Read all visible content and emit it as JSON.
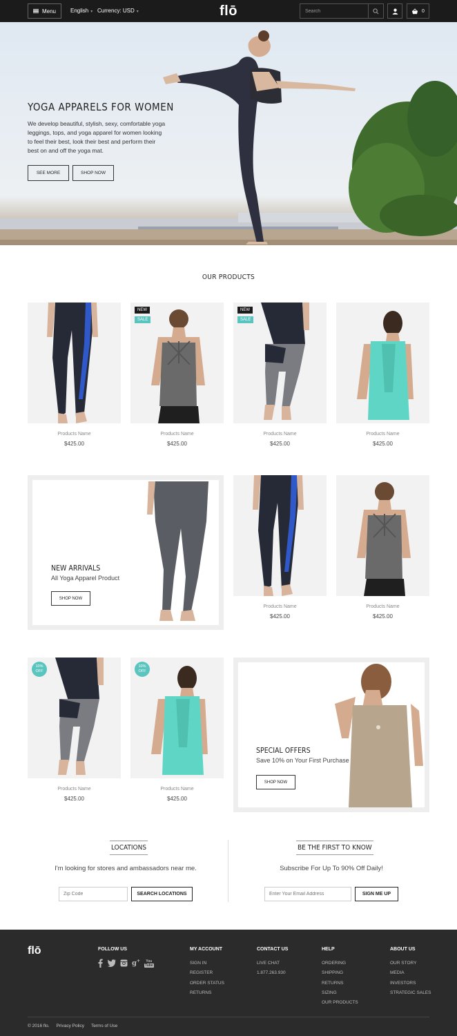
{
  "header": {
    "menu_label": "Menu",
    "language": "English",
    "currency": "Currency: USD",
    "logo": "flō",
    "search_placeholder": "Search",
    "cart_count": "0"
  },
  "hero": {
    "title": "YOGA APPARELS FOR WOMEN",
    "text": "We develop beautiful, stylish, sexy, comfortable yoga leggings, tops, and yoga apparel for women looking to feel their best, look their best and perform their best on and off the yoga mat.",
    "btn_see_more": "SEE MORE",
    "btn_shop_now": "SHOP NOW"
  },
  "products_section": {
    "title": "OUR PRODUCTS",
    "items": [
      {
        "name": "Products Name",
        "price": "$425.00",
        "badges": []
      },
      {
        "name": "Products Name",
        "price": "$425.00",
        "badges": [
          "NEW",
          "SALE"
        ]
      },
      {
        "name": "Products Name",
        "price": "$425.00",
        "badges": [
          "NEW",
          "SALE"
        ]
      },
      {
        "name": "Products Name",
        "price": "$425.00",
        "badges": []
      },
      {
        "name": "Products Name",
        "price": "$425.00",
        "badges": []
      },
      {
        "name": "Products Name",
        "price": "$425.00",
        "badges": []
      },
      {
        "name": "Products Name",
        "price": "$425.00",
        "badges": [
          "10% OFF"
        ]
      },
      {
        "name": "Products Name",
        "price": "$425.00",
        "badges": [
          "10% OFF"
        ]
      }
    ],
    "badge_new": "NEW",
    "badge_sale": "SALE",
    "badge_off_1": "10%",
    "badge_off_2": "OFF"
  },
  "promo_new_arrivals": {
    "title": "NEW ARRIVALS",
    "subtitle": "All Yoga Apparel Product",
    "button": "SHOP NOW"
  },
  "promo_special_offers": {
    "title": "SPECIAL OFFERS",
    "subtitle": "Save 10% on Your First Purchase",
    "button": "SHOP NOW"
  },
  "locations": {
    "title": "LOCATIONS",
    "subtitle": "I'm looking for stores and ambassadors near me.",
    "input_placeholder": "Zip Code",
    "button": "SEARCH LOCATIONS"
  },
  "newsletter": {
    "title": "BE THE FIRST TO KNOW",
    "subtitle": "Subscribe For Up To 90% Off Daily!",
    "input_placeholder": "Enter Your Email Address",
    "button": "SIGN ME UP"
  },
  "footer": {
    "logo": "flō",
    "follow_us": "FOLLOW US",
    "social_icons": [
      "facebook-icon",
      "twitter-icon",
      "instagram-icon",
      "google-plus-icon",
      "youtube-icon"
    ],
    "my_account": {
      "title": "MY ACCOUNT",
      "links": [
        "SIGN IN",
        "REGISTER",
        "ORDER STATUS",
        "RETURNS"
      ]
    },
    "contact_us": {
      "title": "CONTACT US",
      "links": [
        "LIVE CHAT",
        "1.877.263.930"
      ]
    },
    "help": {
      "title": "HELP",
      "links": [
        "ORDERING",
        "SHIPPING",
        "RETURNS",
        "SIZING",
        "OUR PRODUCTS"
      ]
    },
    "about_us": {
      "title": "ABOUT US",
      "links": [
        "OUR STORY",
        "MEDIA",
        "INVESTORS",
        "STRATEGIC SALES"
      ]
    },
    "copyright": "© 2016 flo.",
    "privacy": "Privacy Policy",
    "terms": "Terms of Use"
  },
  "colors": {
    "header_bg": "#1b1b1b",
    "footer_bg": "#2b2b2b",
    "accent_teal": "#5ac4be"
  }
}
